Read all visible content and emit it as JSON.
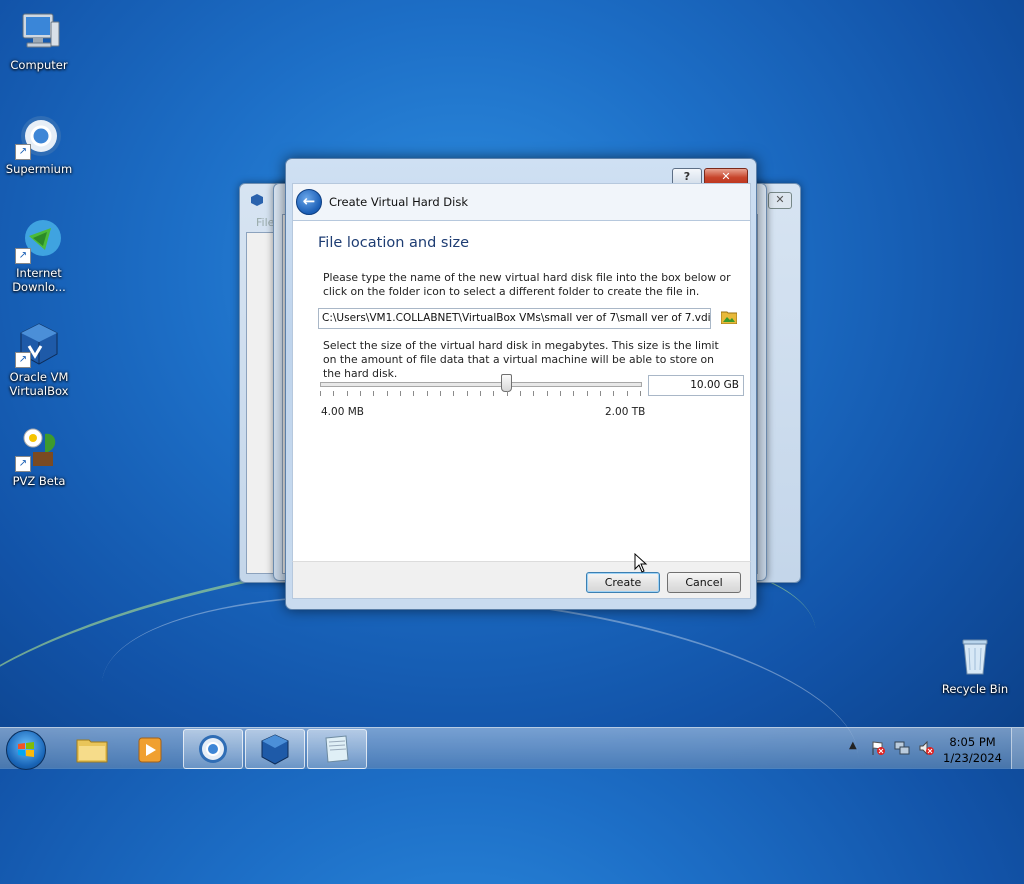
{
  "desktop": {
    "icons": [
      {
        "label": "Computer",
        "icon": "computer-icon"
      },
      {
        "label": "Supermium",
        "icon": "supermium-browser-icon"
      },
      {
        "label": "Internet Downlo...",
        "icon": "internet-download-manager-icon"
      },
      {
        "label": "Oracle VM VirtualBox",
        "icon": "virtualbox-icon"
      },
      {
        "label": "PVZ Beta",
        "icon": "pvz-icon"
      },
      {
        "label": "Recycle Bin",
        "icon": "recycle-bin-icon"
      }
    ]
  },
  "background_window": {
    "menu_partial": "File"
  },
  "dialog": {
    "title": "Create Virtual Hard Disk",
    "help_label": "?",
    "close_label": "✕",
    "section_title": "File location and size",
    "location_text": "Please type the name of the new virtual hard disk file into the box below or click on the folder icon to select a different folder to create the file in.",
    "file_path": "C:\\Users\\VM1.COLLABNET\\VirtualBox VMs\\small ver of 7\\small ver of 7.vdi",
    "size_text": "Select the size of the virtual hard disk in megabytes. This size is the limit on the amount of file data that a virtual machine will be able to store on the hard disk.",
    "size_value": "10.00 GB",
    "slider_fraction": 0.58,
    "min_label": "4.00 MB",
    "max_label": "2.00 TB",
    "create_label": "Create",
    "cancel_label": "Cancel"
  },
  "taskbar": {
    "apps": [
      "file-explorer-icon",
      "media-player-icon",
      "supermium-browser-icon",
      "virtualbox-icon",
      "notepad-icon"
    ],
    "time": "8:05 PM",
    "date": "1/23/2024"
  },
  "colors": {
    "accent": "#1e3d73",
    "desktop": "#1d6fc7"
  }
}
